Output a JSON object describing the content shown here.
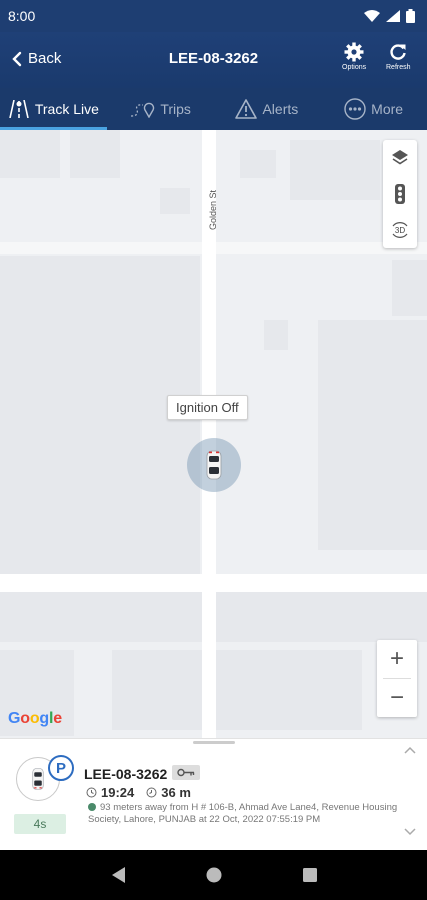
{
  "status_bar": {
    "time": "8:00"
  },
  "header": {
    "back_label": "Back",
    "title": "LEE-08-3262",
    "options_label": "Options",
    "refresh_label": "Refresh"
  },
  "tabs": [
    {
      "label": "Track Live",
      "icon": "road-icon",
      "active": true
    },
    {
      "label": "Trips",
      "icon": "route-pin-icon",
      "active": false
    },
    {
      "label": "Alerts",
      "icon": "warning-icon",
      "active": false
    },
    {
      "label": "More",
      "icon": "more-dots-icon",
      "active": false
    }
  ],
  "map": {
    "street_name": "Golden St",
    "marker_label": "Ignition Off",
    "three_d_label": "3D",
    "zoom_in": "+",
    "zoom_out": "−",
    "attribution": "Google"
  },
  "vehicle_card": {
    "plate": "LEE-08-3262",
    "parking_badge": "P",
    "duration": "4s",
    "time": "19:24",
    "stop_duration": "36 m",
    "address": "93 meters away from H # 106-B, Ahmad Ave Lane4, Revenue Housing Society, Lahore, PUNJAB at 22 Oct, 2022 07:55:19 PM",
    "status_color": "#4a8a6a"
  },
  "colors": {
    "header_bg": "#1f4077",
    "tab_active_indicator": "#4aa3e2",
    "parking_blue": "#2d6cc0"
  }
}
